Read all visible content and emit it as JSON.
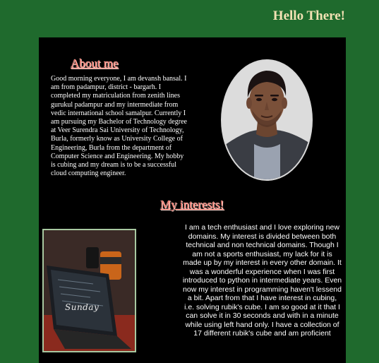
{
  "header": {
    "title": "Hello There!"
  },
  "about": {
    "heading": "About me",
    "text": "Good morning everyone, I am devansh bansal. I am from padampur, district - bargarh. I completed my matriculation from zenith lines gurukul padampur and my intermediate from vedic international school samalpur. Currently I am pursuing my Bachelor of Technology degree at Veer Surendra Sai University of Technology, Burla, formerly know as University College of Engineering, Burla from the department of Computer Science and Engineering. My hobby is cubing and my dream is to be a successful cloud computing engineer."
  },
  "interests": {
    "heading": "My interests!",
    "text": "I am a tech enthusiast and I love exploring new domains. My interest is divided between both technical and non technical domains. Though I am not a sports enthusiast, my lack for it is made up by my interest in every other domain. It was a wonderful experience when I was first introduced to python in intermediate years. Even now my interest in programming haven't lessend a bit. Apart from that I have interest in cubing, i.e. solving rubik's cube. I am so good at it that I can solve it in 30 seconds and with in a minute while using left hand only. I have a collection of 17 different rubik's cube and am proficient",
    "photo_caption": "Sunday"
  },
  "colors": {
    "page_background": "#1f6a2d",
    "panel_background": "#000000",
    "header_text": "#f3e2b4",
    "heading_text": "#ff7b6f"
  },
  "icons": {
    "avatar": "profile-photo",
    "interest_image": "laptop-photo"
  }
}
